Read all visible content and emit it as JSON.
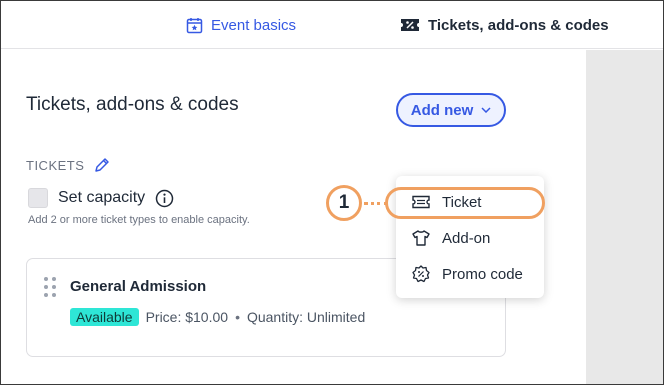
{
  "tabs": {
    "basics_label": "Event basics",
    "tickets_label": "Tickets, add-ons & codes"
  },
  "main": {
    "title": "Tickets, add-ons & codes",
    "add_new_label": "Add new",
    "tickets_section_label": "TICKETS",
    "set_capacity_label": "Set capacity",
    "capacity_hint": "Add 2 or more ticket types to enable capacity."
  },
  "ticket_card": {
    "name": "General Admission",
    "status": "Available",
    "price": "Price: $10.00",
    "separator": "•",
    "quantity": "Quantity: Unlimited"
  },
  "menu": {
    "items": [
      {
        "label": "Ticket",
        "icon": "ticket-icon"
      },
      {
        "label": "Add-on",
        "icon": "shirt-icon"
      },
      {
        "label": "Promo code",
        "icon": "promo-badge-icon"
      }
    ]
  },
  "callout": {
    "number": "1"
  },
  "colors": {
    "accent": "#3659e3",
    "badge": "#2ee6d6",
    "callout": "#f0a060"
  }
}
